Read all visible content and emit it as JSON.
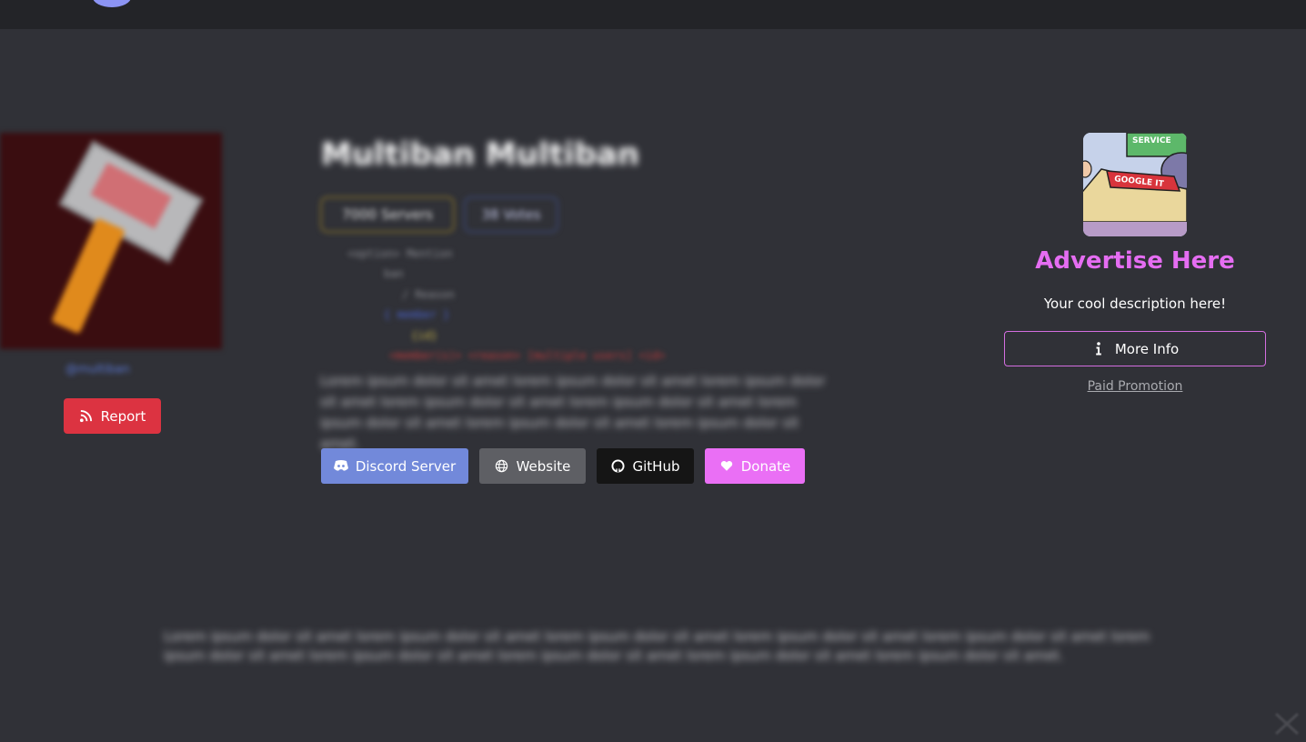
{
  "bot": {
    "title": "Multiban Multiban",
    "owner": "@multiban",
    "servers_badge": "7000 Servers",
    "votes_badge": "38 Votes",
    "code_lines": [
      "<option> Mention",
      "ban",
      "/ Reason",
      "{ member }",
      "{id}",
      "<member(s)> <reason> [multiple users] <id>"
    ],
    "description": "Lorem ipsum dolor sit amet lorem ipsum dolor sit amet lorem ipsum dolor sit amet lorem ipsum dolor sit amet lorem ipsum dolor sit amet lorem ipsum dolor sit amet lorem ipsum dolor sit amet lorem ipsum dolor sit amet.",
    "long_description": "Lorem ipsum dolor sit amet lorem ipsum dolor sit amet lorem ipsum dolor sit amet lorem ipsum dolor sit amet lorem ipsum dolor sit amet lorem ipsum dolor sit amet lorem ipsum dolor sit amet lorem ipsum dolor sit amet lorem ipsum dolor sit amet lorem ipsum dolor sit amet."
  },
  "actions": {
    "report_label": "Report",
    "discord_label": "Discord Server",
    "website_label": "Website",
    "github_label": "GitHub",
    "donate_label": "Donate"
  },
  "ad": {
    "title": "Advertise Here",
    "description": "Your cool description here!",
    "more_info_label": "More Info",
    "paid_promo_label": "Paid Promotion",
    "image_text_1": "SERVICE",
    "image_text_2": "GOOGLE IT"
  },
  "colors": {
    "background": "#303137",
    "topbar": "#232428",
    "report": "#dc3341",
    "discord": "#7289da",
    "website": "#5e5f64",
    "github": "#151515",
    "donate": "#ea6ff5",
    "ad_accent": "#e56df2"
  },
  "icons": {
    "report": "rss-icon",
    "discord": "discord-icon",
    "website": "globe-icon",
    "github": "github-icon",
    "donate": "heart-icon",
    "more_info": "info-icon"
  }
}
